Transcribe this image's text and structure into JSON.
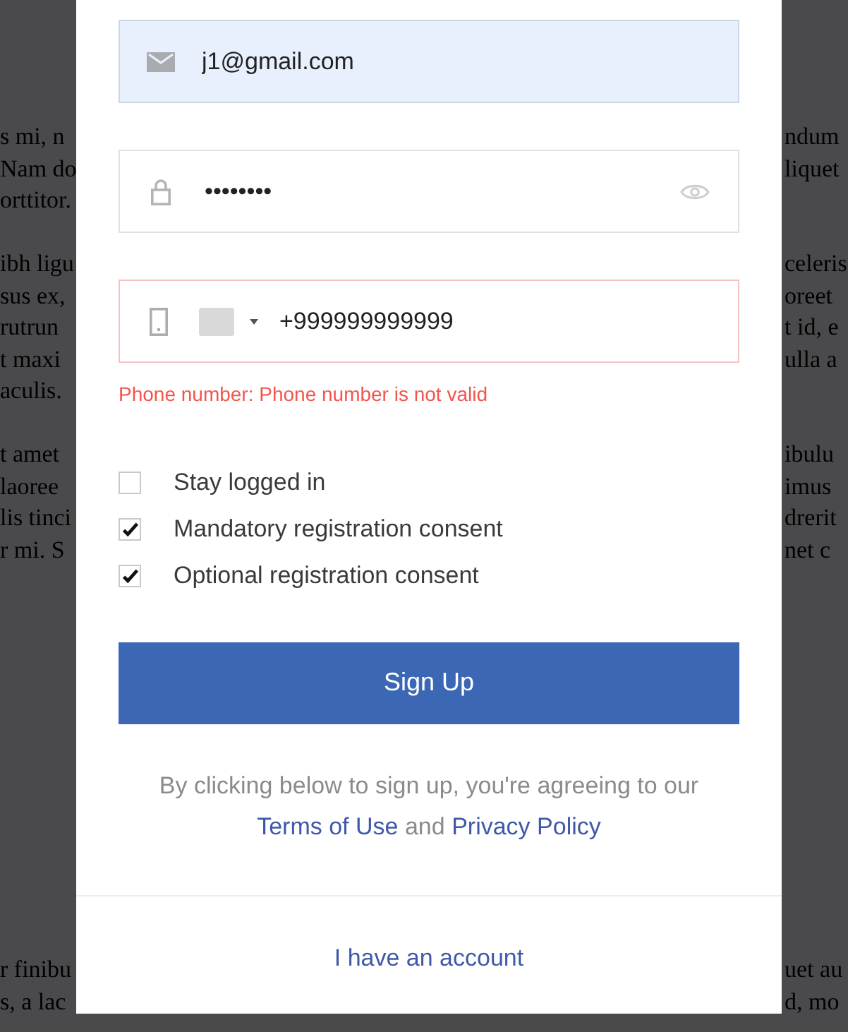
{
  "background_text": [
    [
      {
        "left": "s mi, n",
        "right": "ndum"
      },
      {
        "left": "Nam do",
        "right": "liquet"
      },
      {
        "left": "orttitor."
      }
    ],
    [
      {
        "left": "ibh ligu",
        "right": "celeris"
      },
      {
        "left": "sus ex,",
        "right": "oreet"
      },
      {
        "left": "rutrun",
        "right": "t id, e"
      },
      {
        "left": "t maxi",
        "right": "ulla a"
      },
      {
        "left": "aculis."
      }
    ],
    [
      {
        "left": "t amet",
        "right": "ibulu"
      },
      {
        "left": "laoree",
        "right": "imus"
      },
      {
        "left": "lis tinci",
        "right": "drerit"
      },
      {
        "left": "r mi. S",
        "right": "net c"
      }
    ],
    [
      {
        "left": "r finibu",
        "right": "uet au"
      },
      {
        "left": "s, a lac",
        "right": "d, mo"
      }
    ]
  ],
  "form": {
    "fields": [
      {
        "kind": "email",
        "value": "j1@gmail.com",
        "autofilled": true,
        "invalid": false
      },
      {
        "kind": "password",
        "value": "••••••••",
        "autofilled": false,
        "invalid": false
      },
      {
        "kind": "phone",
        "value": "+999999999999",
        "autofilled": false,
        "invalid": true,
        "error": "Phone number: Phone number is not valid"
      }
    ],
    "checkboxes": [
      {
        "label": "Stay logged in",
        "checked": false
      },
      {
        "label": "Mandatory registration consent",
        "checked": true
      },
      {
        "label": "Optional registration consent",
        "checked": true
      }
    ],
    "submit": "Sign Up",
    "terms": [
      {
        "kind": "text",
        "text": "By clicking below to sign up, you're agreeing to our"
      },
      {
        "kind": "link",
        "text": "Terms of Use"
      },
      {
        "kind": "text",
        "text": "and"
      },
      {
        "kind": "link",
        "text": "Privacy Policy"
      }
    ]
  },
  "account_link": "I have an account"
}
